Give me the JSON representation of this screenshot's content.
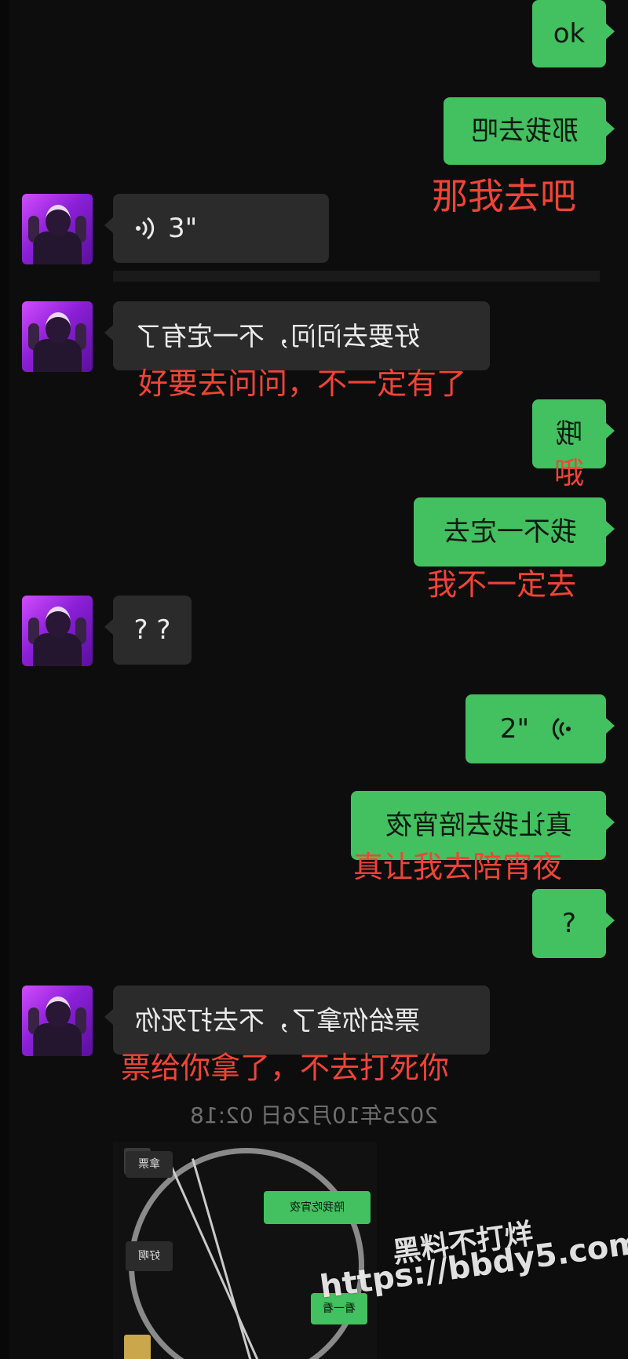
{
  "colors": {
    "background": "#0d0d0d",
    "received_bubble": "#2b2b2b",
    "sent_bubble": "#43c05f",
    "caption_red": "#f04436"
  },
  "messages": [
    {
      "side": "right",
      "text": "ok",
      "mirrored": false
    },
    {
      "side": "right",
      "text": "那我去吧",
      "mirrored": true,
      "caption": "那我去吧"
    },
    {
      "side": "left",
      "kind": "voice",
      "text": "3\"",
      "icon": "voice-wave-icon"
    },
    {
      "side": "left",
      "text": "好要去问问，不一定有了",
      "mirrored": true,
      "caption": "好要去问问，不一定有了"
    },
    {
      "side": "right",
      "text": "哦",
      "mirrored": true,
      "caption": "哦"
    },
    {
      "side": "right",
      "text": "我不一定去",
      "mirrored": true,
      "caption": "我不一定去"
    },
    {
      "side": "left",
      "text": "? ?",
      "mirrored": false
    },
    {
      "side": "right",
      "kind": "voice",
      "text": "2\"",
      "icon": "voice-wave-icon"
    },
    {
      "side": "right",
      "text": "真让我去陪宵夜",
      "mirrored": true,
      "caption": "真让我去陪宵夜"
    },
    {
      "side": "right",
      "text": "?",
      "mirrored": false
    },
    {
      "side": "left",
      "text": "票给你拿了，不去打死你",
      "mirrored": true,
      "caption": "票给你拿了，不去打死你"
    }
  ],
  "timestamp": "2025年10月26日 02:18",
  "embedded_screenshot": {
    "bubbles": [
      {
        "side": "left",
        "text": "拿票"
      },
      {
        "side": "right",
        "text": "陪我吃宵夜"
      },
      {
        "side": "left",
        "text": "好啊"
      },
      {
        "side": "right",
        "text": "看一看"
      }
    ]
  },
  "watermark": {
    "line1": "黑料不打烊",
    "line2": "https://bbdy5.com"
  }
}
